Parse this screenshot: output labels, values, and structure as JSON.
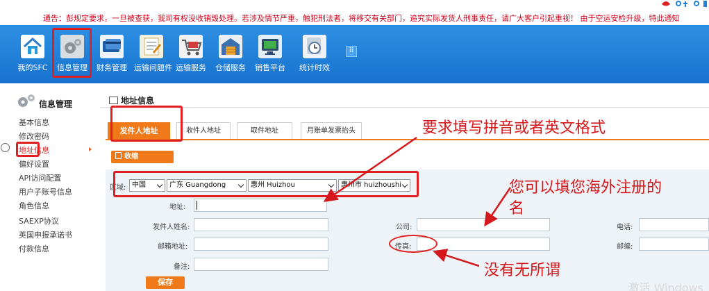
{
  "notice": {
    "text": "通告：彭规定要求，一旦被查获，我司有权没收销毁处理。若涉及情节严重，触犯刑法者，将移交有关部门，追究实际发货人刑事责任，请广大客户引起重视！ 由于空运安检升级，特此通知"
  },
  "nav": {
    "items": [
      {
        "label": "我的SFC",
        "icon": "home-icon"
      },
      {
        "label": "信息管理",
        "icon": "gears-icon"
      },
      {
        "label": "财务管理",
        "icon": "credit-card-icon"
      },
      {
        "label": "运输问题件",
        "icon": "notepad-icon"
      },
      {
        "label": "运输服务",
        "icon": "cart-icon"
      },
      {
        "label": "仓储服务",
        "icon": "warehouse-icon"
      },
      {
        "label": "销售平台",
        "icon": "monitor-icon"
      },
      {
        "label": "统计时效",
        "icon": "clock-icon"
      }
    ]
  },
  "sidebar": {
    "title": "信息管理",
    "items": [
      {
        "label": "基本信息"
      },
      {
        "label": "修改密码"
      },
      {
        "label": "地址信息"
      },
      {
        "label": "偏好设置"
      },
      {
        "label": "API访问配置"
      },
      {
        "label": "用户子账号信息"
      },
      {
        "label": "角色信息"
      },
      {
        "label": "SAEXP协议"
      },
      {
        "label": "英国申报承诺书"
      },
      {
        "label": "付款信息"
      }
    ]
  },
  "main": {
    "title": "地址信息",
    "tabs": [
      {
        "label": "发件人地址"
      },
      {
        "label": "收件人地址"
      },
      {
        "label": "取件地址"
      },
      {
        "label": "月账单发票抬头"
      }
    ],
    "collapse_label": "收缩",
    "form": {
      "region_label": "区域:",
      "country": "中国",
      "province": "广东 Guangdong",
      "city": "惠州 Huizhou",
      "district": "惠州市 huizhoushi",
      "address_label": "地址:",
      "address_value": "",
      "sender_name_label": "发件人姓名:",
      "company_label": "公司:",
      "phone_label": "电话:",
      "email_label": "邮箱地址:",
      "fax_label": "传真:",
      "postcode_label": "邮编:",
      "note_label": "备注:",
      "save_label": "保存"
    }
  },
  "annotations": {
    "pinyin_note": "要求填写拼音或者英文格式",
    "overseas_note_line1": "您可以填您海外注册的",
    "overseas_note_line2": "名",
    "fax_note": "没有无所谓"
  },
  "watermark": "激活 Windows",
  "colors": {
    "nav_blue": "#1e80d8",
    "accent_orange": "#f07a1a",
    "annotation_red": "#d4181b",
    "form_bg": "#eef3f8"
  }
}
